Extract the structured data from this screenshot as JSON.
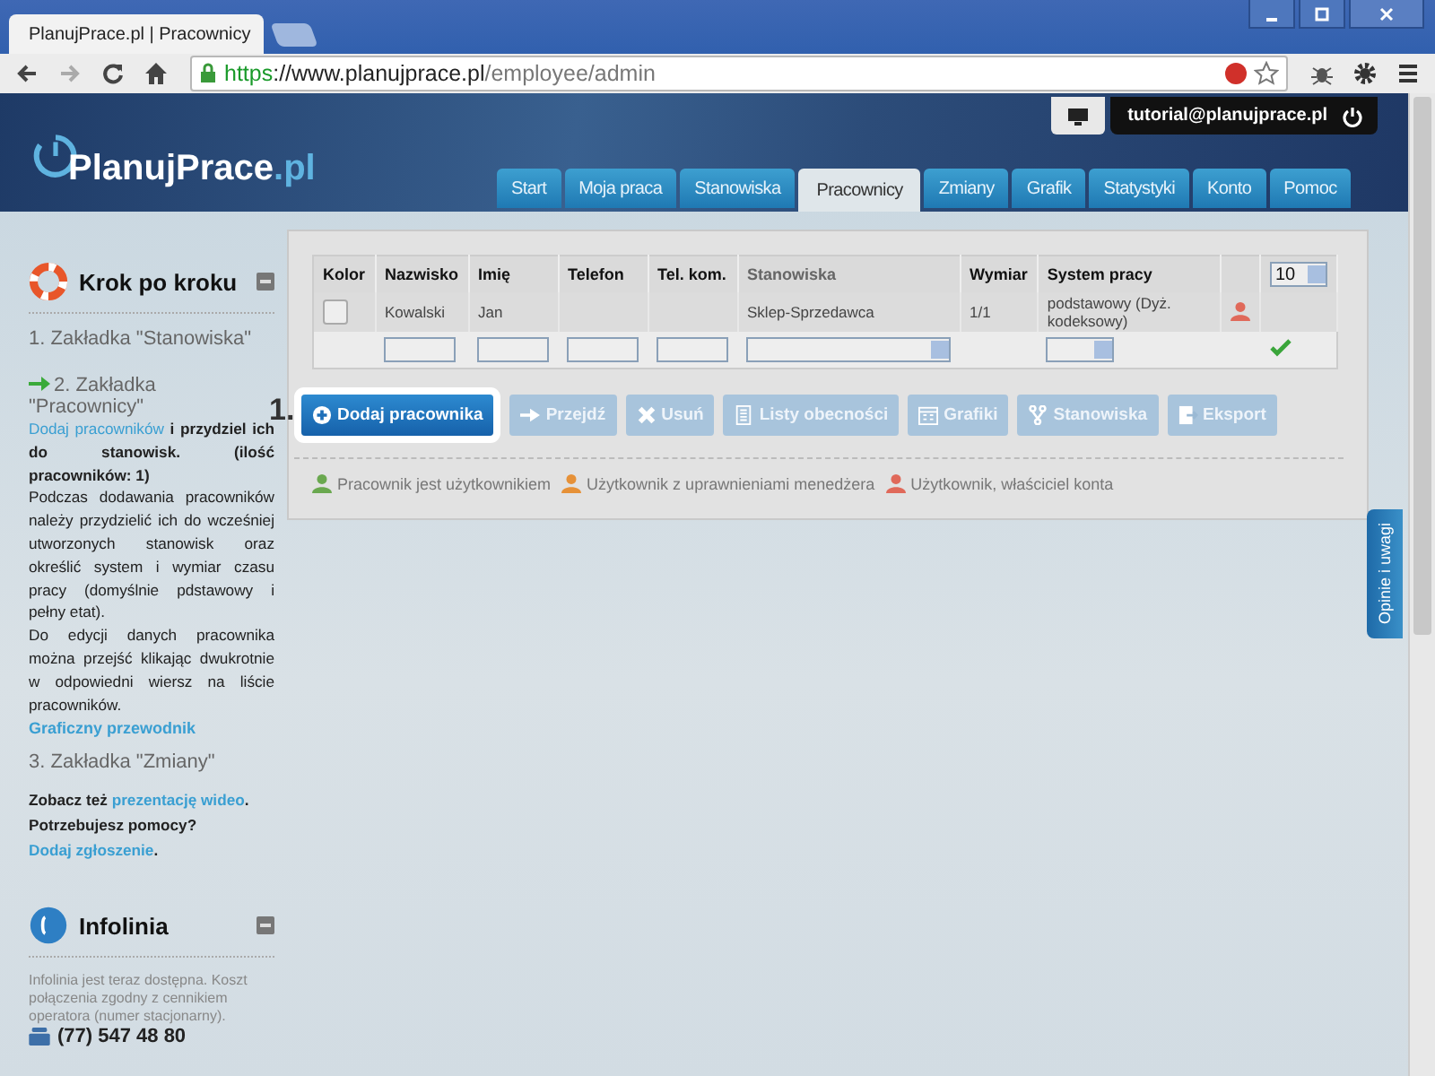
{
  "browser": {
    "tab_title": "PlanujPrace.pl | Pracownicy",
    "url": [
      {
        "kind": "scheme",
        "text": "https"
      },
      {
        "kind": "host",
        "text": "://www.planujprace.pl"
      },
      {
        "kind": "path",
        "text": "/employee/admin"
      }
    ]
  },
  "header": {
    "logo": [
      "PlanujPrace",
      ".pl"
    ],
    "user_email": "tutorial@planujprace.pl",
    "tabs": [
      {
        "label": "Start",
        "selected": false
      },
      {
        "label": "Moja praca",
        "selected": false
      },
      {
        "label": "Stanowiska",
        "selected": false
      },
      {
        "label": "Pracownicy",
        "selected": true
      },
      {
        "label": "Zmiany",
        "selected": false
      },
      {
        "label": "Grafik",
        "selected": false
      },
      {
        "label": "Statystyki",
        "selected": false
      },
      {
        "label": "Konto",
        "selected": false
      },
      {
        "label": "Pomoc",
        "selected": false
      }
    ]
  },
  "guide": {
    "title": "Krok po kroku",
    "steps": [
      {
        "title": "1. Zakładka \"Stanowiska\"",
        "current": false
      },
      {
        "title": "2. Zakładka \"Pracownicy\"",
        "current": true,
        "intro": [
          {
            "kind": "link",
            "text": "Dodaj pracowników"
          },
          {
            "kind": "bold",
            "text": " i przydziel ich do stanowisk. (ilość pracowników: 1)"
          }
        ],
        "paragraphs": [
          "Podczas dodawania pracowników należy przydzielić ich do wcześniej utworzonych stanowisk oraz określić system i wymiar czasu pracy (domyślnie pdstawowy i pełny etat).",
          "Do edycji danych pracownika można przejść klikając dwukrotnie w odpowiedni wiersz na liście pracowników."
        ],
        "link": "Graficzny przewodnik"
      },
      {
        "title": "3. Zakładka \"Zmiany\"",
        "current": false
      }
    ],
    "help": [
      [
        {
          "kind": "bold",
          "text": "Zobacz też "
        },
        {
          "kind": "link",
          "text": "prezentację wideo"
        },
        {
          "kind": "bold",
          "text": "."
        }
      ],
      [
        {
          "kind": "bold",
          "text": "Potrzebujesz pomocy? "
        },
        {
          "kind": "link",
          "text": "Dodaj zgłoszenie"
        },
        {
          "kind": "bold",
          "text": "."
        }
      ]
    ]
  },
  "hotline": {
    "title": "Infolinia",
    "text": "Infolinia jest teraz dostępna. Koszt połączenia zgodny z cennikiem operatora (numer stacjonarny).",
    "phone": "(77) 547 48 80"
  },
  "table": {
    "columns": [
      "Kolor",
      "Nazwisko",
      "Imię",
      "Telefon",
      "Tel. kom.",
      "Stanowiska",
      "Wymiar",
      "System pracy"
    ],
    "page_size": "10",
    "rows": [
      {
        "cells": [
          "",
          "Kowalski",
          "Jan",
          "",
          "",
          "Sklep-Sprzedawca",
          "1/1",
          "podstawowy (Dyż. kodeksowy)"
        ],
        "color": "#e0695a"
      }
    ]
  },
  "step_marker": "1.",
  "buttons": [
    {
      "kind": "add",
      "label": "Dodaj pracownika",
      "disabled": false
    },
    {
      "kind": "go",
      "label": "Przejdź",
      "disabled": true
    },
    {
      "kind": "delete",
      "label": "Usuń",
      "disabled": true
    },
    {
      "kind": "list",
      "label": "Listy obecności",
      "disabled": true
    },
    {
      "kind": "calendar",
      "label": "Grafiki",
      "disabled": true
    },
    {
      "kind": "branch",
      "label": "Stanowiska",
      "disabled": true
    },
    {
      "kind": "export",
      "label": "Eksport",
      "disabled": true
    }
  ],
  "legend": [
    {
      "label": "Pracownik jest użytkownikiem",
      "color": "#6aa84f"
    },
    {
      "label": "Użytkownik z uprawnieniami menedżera",
      "color": "#e69138"
    },
    {
      "label": "Użytkownik, właściciel konta",
      "color": "#e0695a"
    }
  ],
  "feedback": "Opinie i uwagi"
}
